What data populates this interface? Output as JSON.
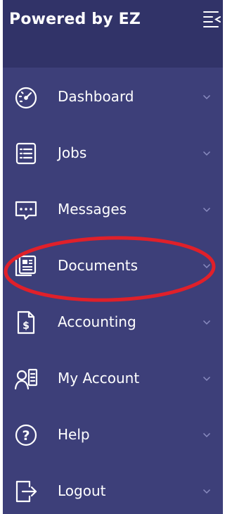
{
  "brand": {
    "title": "Powered by EZ"
  },
  "nav": {
    "items": [
      {
        "label": "Dashboard",
        "icon": "dashboard-icon"
      },
      {
        "label": "Jobs",
        "icon": "list-icon"
      },
      {
        "label": "Messages",
        "icon": "chat-icon"
      },
      {
        "label": "Documents",
        "icon": "documents-icon"
      },
      {
        "label": "Accounting",
        "icon": "invoice-icon"
      },
      {
        "label": "My Account",
        "icon": "user-card-icon"
      },
      {
        "label": "Help",
        "icon": "help-icon"
      },
      {
        "label": "Logout",
        "icon": "logout-icon"
      }
    ]
  },
  "colors": {
    "sidebar_bg": "#3d3f79",
    "header_bg": "#313368",
    "highlight_ring": "#e0202a"
  }
}
